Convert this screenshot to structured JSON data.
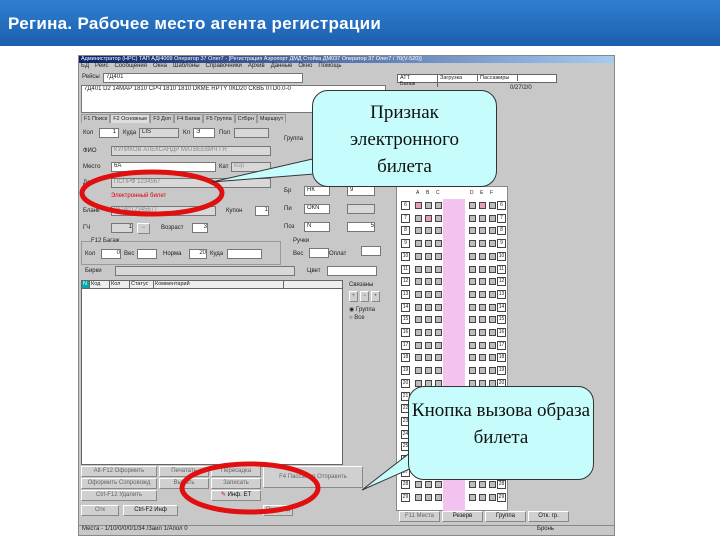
{
  "slide": {
    "title": "Регина. Рабочее место агента регистрации"
  },
  "window": {
    "title": "Администратор (НРС) ТАП АД/4009 Оператор 37 Олег7 - [Регистрация Аэропорт ДМД Стойка ДМ037 Оператор 37 Олег7 / 70(V-520)]",
    "menu": [
      "БД",
      "Рейс",
      "Сообщения",
      "Окна",
      "Шаблоны",
      "Справочники",
      "Архив",
      "Данные",
      "Окно",
      "Помощь"
    ],
    "flight_label": "Рейсы",
    "flight_value": "7Д401",
    "flight_info": "7Д401 D2 14МАР 1810 СРЧ 1810 1810 DКМЕ RPTY 0КD20 СКВБ 0ТD0.0-0",
    "right_tabs": [
      "АТТ",
      "Загрузка",
      "Пассажиры",
      "Багаж"
    ],
    "right_value": "0/27/2/0",
    "tabs": [
      "F1 Поиск",
      "F2 Основные",
      "F3 Доп",
      "F4 Багаж",
      "F5 Группа",
      "СтБрн",
      "Маршрут"
    ],
    "form": {
      "kol_label": "Кол",
      "kol": "1",
      "kuda_label": "Куда",
      "kuda": "LIS",
      "kl_label": "Кл",
      "kl": "Э",
      "pol_label": "Пол",
      "fio_label": "ФИО",
      "fio": "КУЛИКОВ АЛЕКСАНДР МАТВЕЕВИЧ ГН",
      "mesto_label": "Место",
      "mesto": "6A",
      "kat_label": "Кат",
      "kat": "Взр",
      "doc_label": "Док",
      "doc": "ПСПРФ 1234567",
      "eticket": "Электронный билет",
      "blank_label": "Бланк",
      "blank": "2624012345677",
      "kupon_label": "Купон",
      "kupon": "1",
      "gch_label": "ГЧ",
      "gch": "1",
      "vozrast_label": "Возраст",
      "vozrast": "3"
    },
    "side": {
      "gruppa": "Группа",
      "br_label": "Бр",
      "br": "НК",
      "br2": "9",
      "pi_label": "Пи",
      "pi": "ОКN",
      "poz_label": "Поз",
      "poz": "N",
      "poz2": "5"
    },
    "baggage": {
      "legend": "F12 Багаж",
      "kol_label": "Кол",
      "kol": "0",
      "ves_label": "Вес",
      "norma_label": "Норма",
      "norma": "20",
      "kuda_label": "Куда",
      "ruchki_legend": "Ручки",
      "ves2_label": "Вес",
      "oplat_label": "Оплат",
      "birki_label": "Бирки",
      "cvet_label": "Цвет"
    },
    "table_headers": [
      "N",
      "Код",
      "Кол",
      "Статус",
      "Комментарий"
    ],
    "svyazi": {
      "label": "Связаны",
      "plus": "+",
      "minus": "−",
      "dot": "•",
      "opt1": "Группа",
      "opt2": "Все"
    },
    "buttons": {
      "b1": "Alt-F12 Оформить",
      "b2": "Печатать",
      "b3": "Пересадка",
      "b4": "Оформить Сопровожд",
      "b5": "Выдать",
      "b6": "Записать",
      "b7": "Ctrl-F12 Удалить",
      "b8": "Инф. ЕТ",
      "b9": "F4 Пассажир Отправить",
      "b10": "Отк",
      "b11": "Ctrl-F2 Инф",
      "b12": "Перевод"
    },
    "status_left": "Места - 1/10/0/0/0/1/34 /Заил 1/Апол 0",
    "seatmap": {
      "cols": [
        "A",
        "B",
        "C",
        "D",
        "E",
        "F"
      ],
      "first_row": 6,
      "last_row": 29,
      "pink_seats": [
        "6A",
        "6E",
        "7B"
      ]
    },
    "bottom_buttons": [
      "F11 Места",
      "Резерв",
      "Группа",
      "Отк. гр."
    ],
    "status_right": "Бронь"
  },
  "callouts": {
    "c1": "Признак электронного билета",
    "c2": "Кнопка вызова образа билета"
  },
  "colors": {
    "header": "#1c5fae",
    "callout": "#c6fcfc",
    "highlight": "#e01010"
  }
}
